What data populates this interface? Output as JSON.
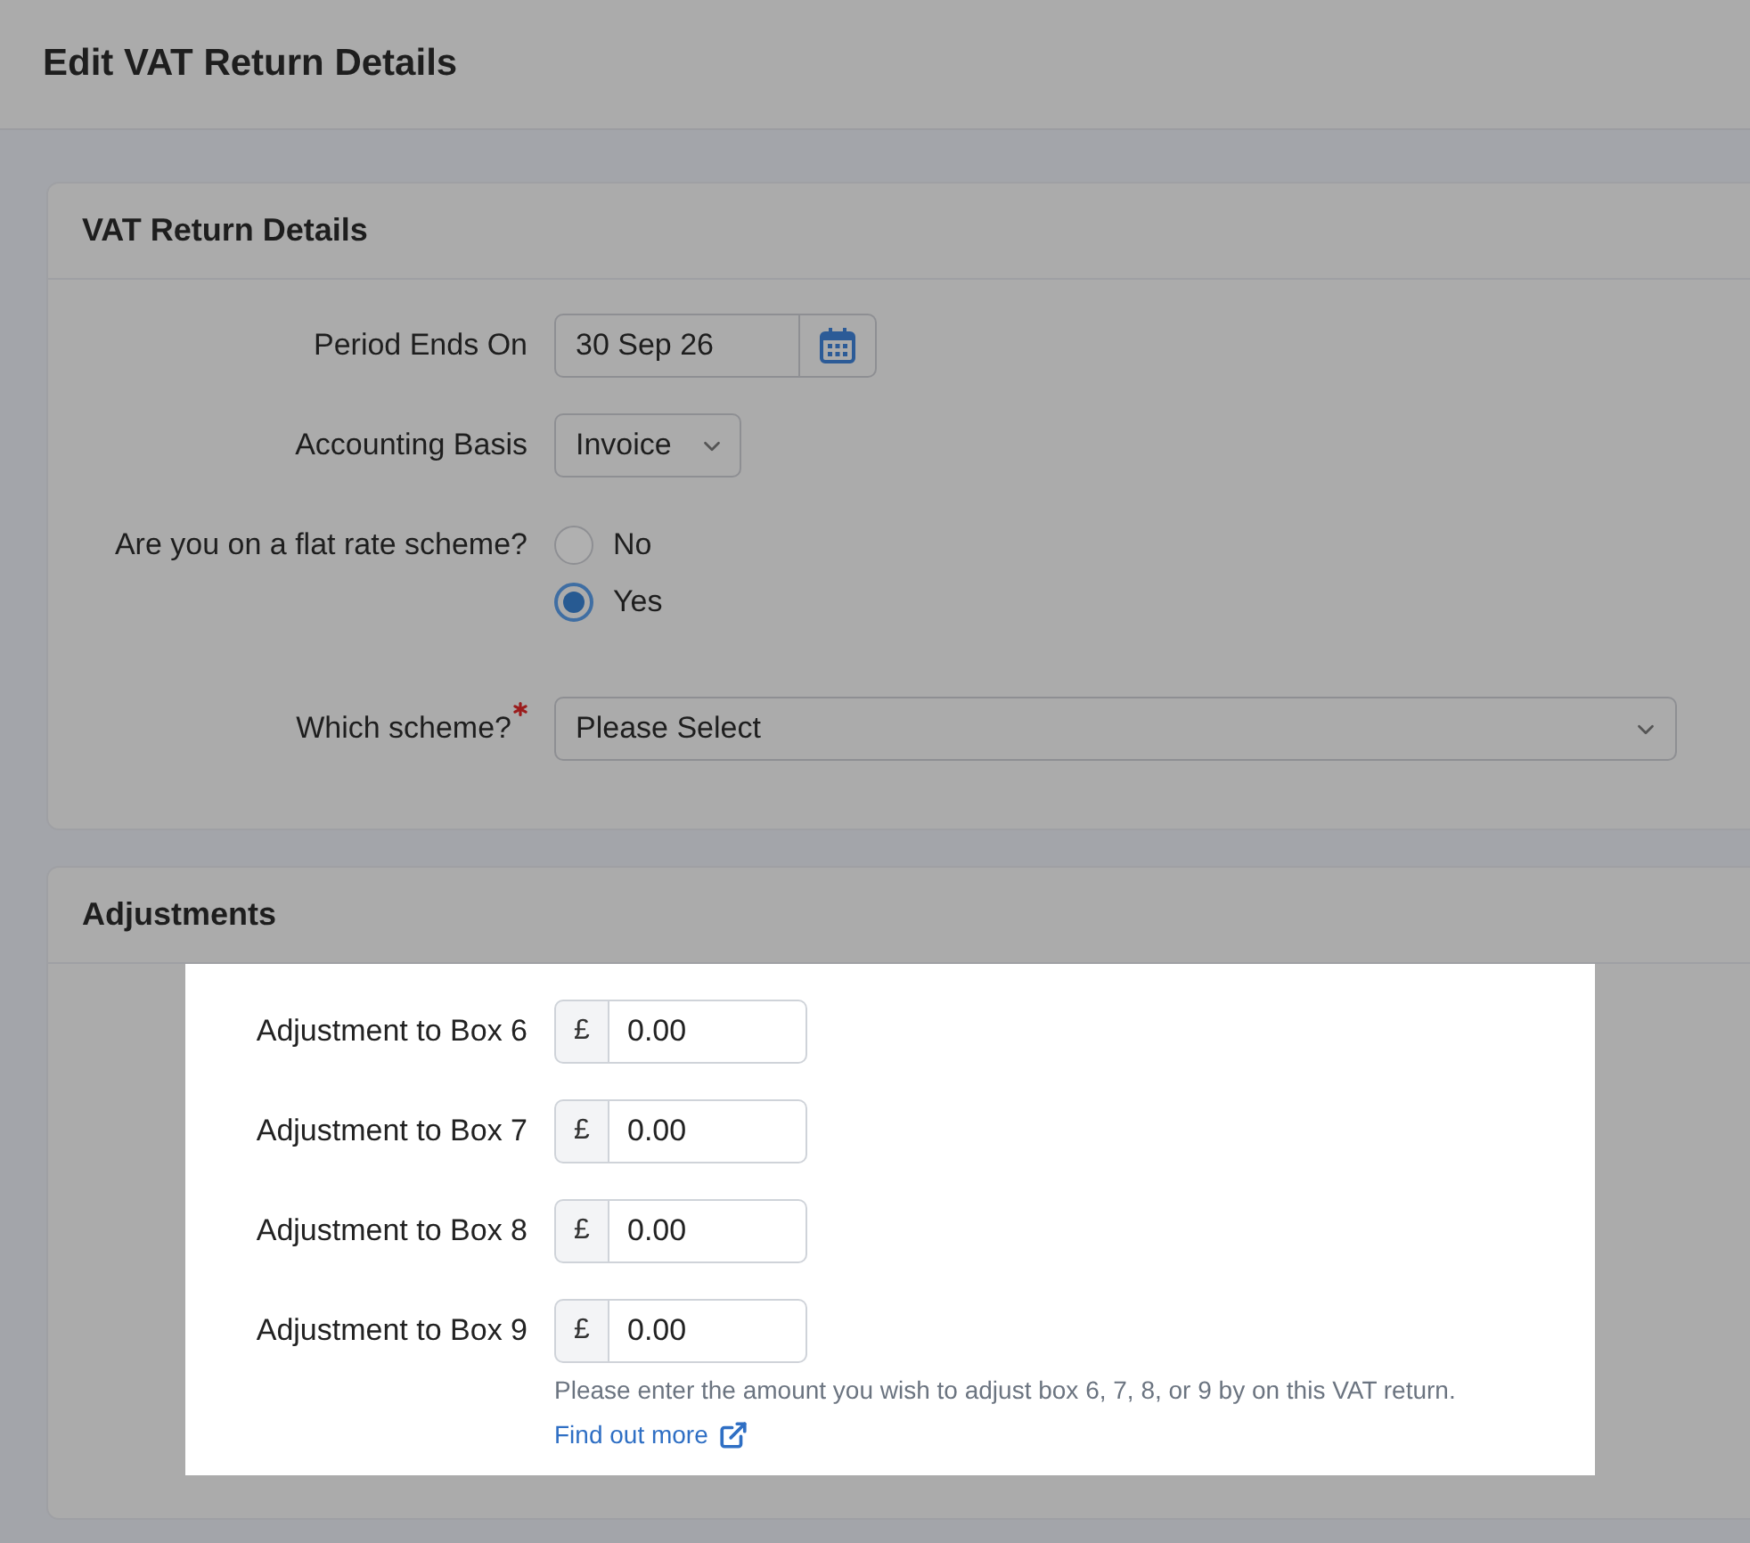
{
  "page": {
    "title": "Edit VAT Return Details"
  },
  "vat_return_details": {
    "title": "VAT Return Details",
    "period_ends_on": {
      "label": "Period Ends On",
      "value": "30 Sep 26"
    },
    "accounting_basis": {
      "label": "Accounting Basis",
      "value": "Invoice"
    },
    "flat_rate_scheme": {
      "label": "Are you on a flat rate scheme?",
      "options": [
        {
          "label": "No",
          "selected": false
        },
        {
          "label": "Yes",
          "selected": true
        }
      ]
    },
    "which_scheme": {
      "label": "Which scheme?",
      "required": true,
      "value": "Please Select"
    }
  },
  "adjustments": {
    "title": "Adjustments",
    "highlighted": true,
    "fields": [
      {
        "label": "Adjustment to Box 6",
        "currency": "£",
        "value": "0.00"
      },
      {
        "label": "Adjustment to Box 7",
        "currency": "£",
        "value": "0.00"
      },
      {
        "label": "Adjustment to Box 8",
        "currency": "£",
        "value": "0.00"
      },
      {
        "label": "Adjustment to Box 9",
        "currency": "£",
        "value": "0.00"
      }
    ],
    "help_text": "Please enter the amount you wish to adjust box 6, 7, 8, or 9 by on this VAT return.",
    "link": "Find out more"
  }
}
